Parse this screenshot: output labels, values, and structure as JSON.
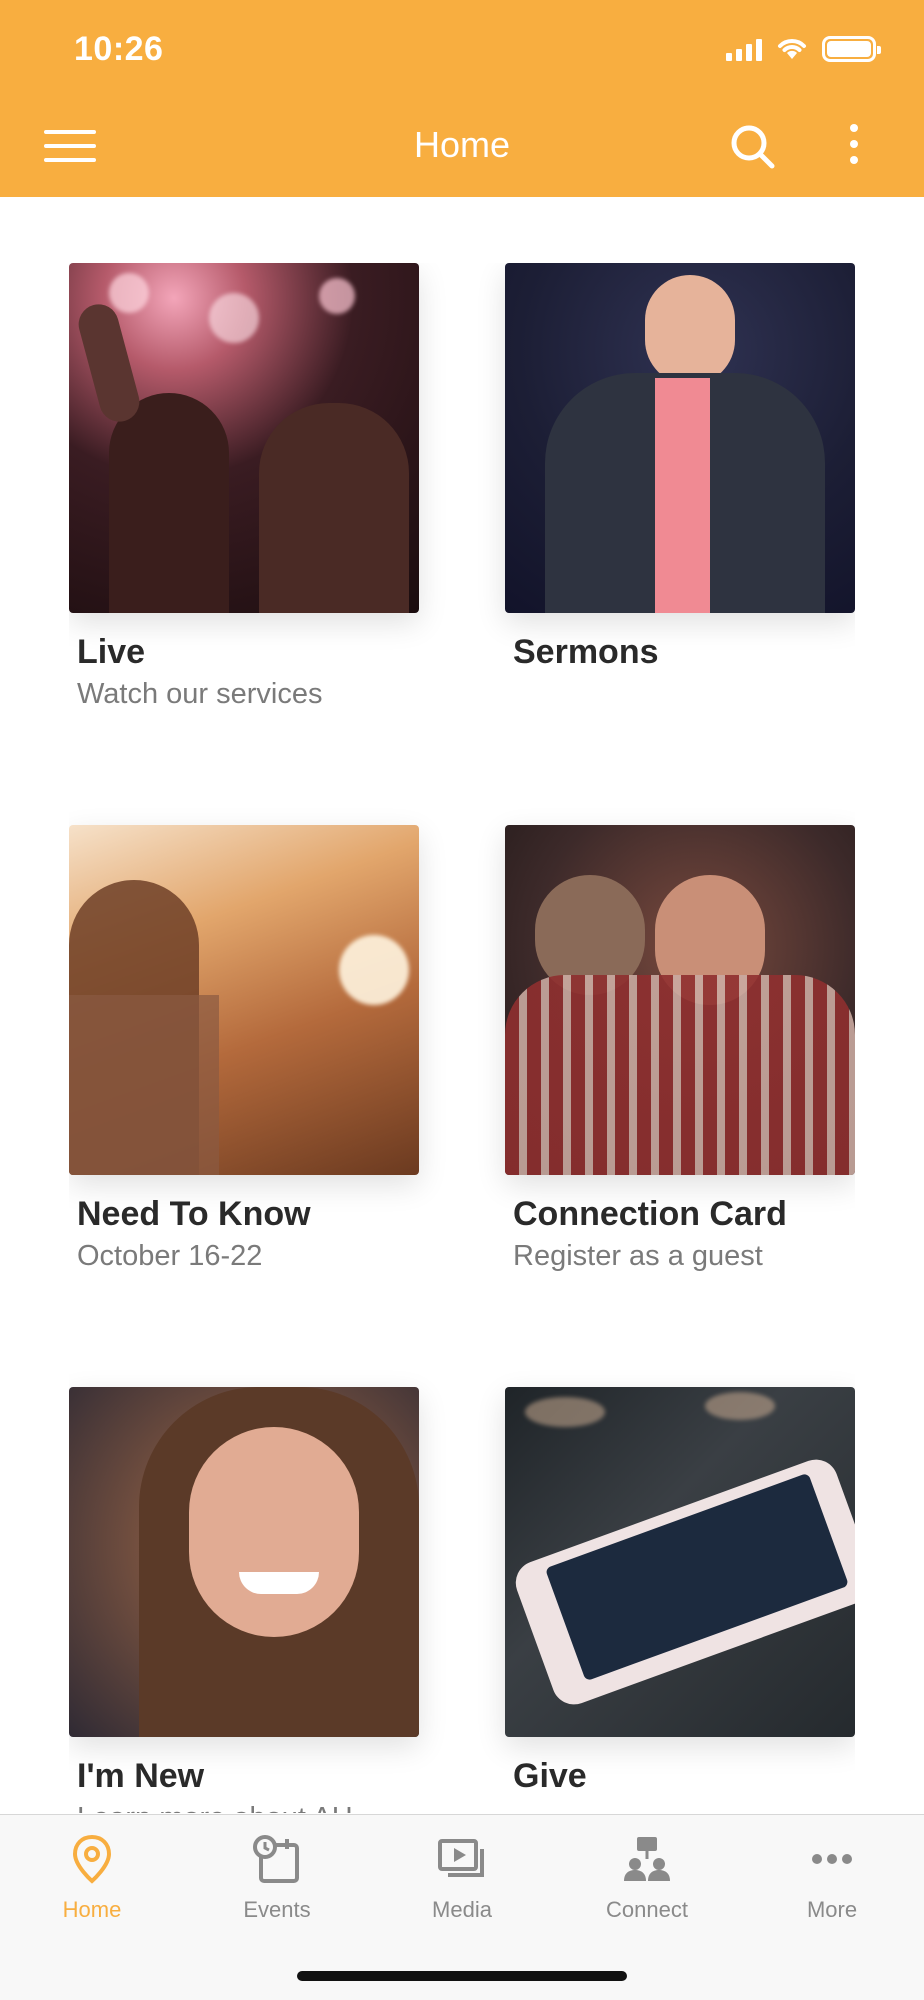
{
  "status_bar": {
    "time": "10:26"
  },
  "header": {
    "title": "Home",
    "accent_color": "#F8AE40"
  },
  "cards": [
    {
      "title": "Live",
      "subtitle": "Watch our services",
      "image": "worship-crowd-photo"
    },
    {
      "title": "Sermons",
      "subtitle": "",
      "image": "preacher-photo"
    },
    {
      "title": "Need To Know",
      "subtitle": "October 16-22",
      "image": "sunset-woman-photo"
    },
    {
      "title": "Connection Card",
      "subtitle": "Register as a guest",
      "image": "hug-photo"
    },
    {
      "title": "I'm New",
      "subtitle": "Learn more about AH",
      "image": "smiling-girl-photo"
    },
    {
      "title": "Give",
      "subtitle": "",
      "image": "phone-on-table-photo"
    }
  ],
  "tabbar": {
    "tabs": [
      {
        "label": "Home",
        "icon": "location-pin-icon",
        "active": true
      },
      {
        "label": "Events",
        "icon": "calendar-clock-icon",
        "active": false
      },
      {
        "label": "Media",
        "icon": "media-play-icon",
        "active": false
      },
      {
        "label": "Connect",
        "icon": "people-icon",
        "active": false
      },
      {
        "label": "More",
        "icon": "more-dots-icon",
        "active": false
      }
    ]
  }
}
